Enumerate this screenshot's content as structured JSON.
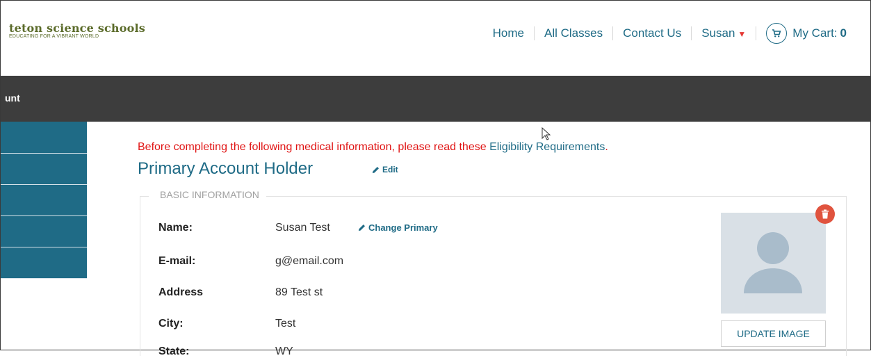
{
  "brand": {
    "title": "teton science schools",
    "tagline": "EDUCATING FOR A VIBRANT WORLD",
    "color": "#5b6b2a"
  },
  "nav": {
    "home": "Home",
    "all_classes": "All Classes",
    "contact": "Contact Us",
    "user": "Susan",
    "cart_label": "My Cart:",
    "cart_count": "0",
    "link_color": "#1f6b86"
  },
  "page_header": {
    "title": "unt"
  },
  "notice": {
    "text": "Before completing the following medical information, please read these ",
    "link": "Eligibility Requirements",
    "end": ".",
    "color": "#e01414"
  },
  "section": {
    "title": "Primary Account Holder",
    "edit_label": "Edit",
    "legend": "BASIC INFORMATION"
  },
  "fields": {
    "name_label": "Name:",
    "name_value": "Susan Test",
    "change_primary": "Change Primary",
    "email_label": "E-mail:",
    "email_value": "g@email.com",
    "address_label": "Address",
    "address_value": "89 Test st",
    "city_label": "City:",
    "city_value": "Test",
    "state_label": "State:",
    "state_value": "WY"
  },
  "avatar": {
    "update_label": "UPDATE IMAGE"
  },
  "icons": {
    "cart": "cart-icon",
    "pencil": "pencil-icon",
    "trash": "trash-icon",
    "caret": "caret-down-icon",
    "avatar": "user-silhouette-icon"
  }
}
